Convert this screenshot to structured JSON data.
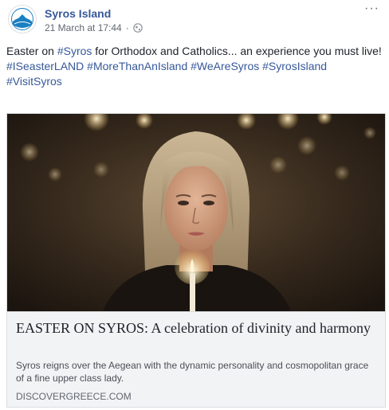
{
  "post": {
    "page_name": "Syros Island",
    "timestamp": "21 March at 17:44",
    "separator": "·",
    "privacy_icon": "globe-icon",
    "more_label": "···",
    "text": {
      "part1": "Easter on ",
      "tag_syros": "#Syros",
      "part2": " for Orthodox and Catholics... an experience you must live!",
      "hashtags": [
        "#ISeasterLAND",
        "#MoreThanAnIsland",
        "#WeAreSyros",
        "#SyrosIsland",
        "#VisitSyros"
      ]
    }
  },
  "link_card": {
    "image_description_icon": "photo-woman-with-candle",
    "title": "EASTER ON SYROS: A celebration of divinity and harmony",
    "description": "Syros reigns over the Aegean with the dynamic personality and cosmopolitan grace of a fine upper class lady.",
    "domain": "DISCOVERGREECE.COM"
  },
  "colors": {
    "link_blue": "#365899",
    "text_dark": "#1d2129",
    "meta_gray": "#616770",
    "card_bg": "#f2f3f5",
    "logo_blue": "#1a7fc1"
  }
}
